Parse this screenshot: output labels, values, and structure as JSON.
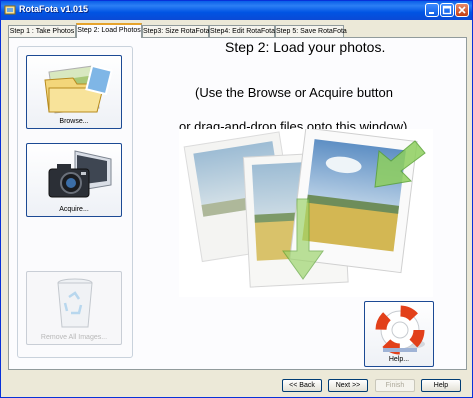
{
  "window": {
    "title": "RotaFota v1.015"
  },
  "tabs": [
    "Step 1 : Take Photos",
    "Step 2: Load Photos",
    "Step3: Size RotaFota",
    "Step4: Edit RotaFota",
    "Step 5: Save RotaFota"
  ],
  "main": {
    "heading": "Step 2: Load your photos.",
    "instruction_line1": "(Use the Browse or Acquire button",
    "instruction_line2": "or drag-and-drop files onto this window)"
  },
  "buttons": {
    "browse": "Browse...",
    "acquire": "Acquire...",
    "remove_all": "Remove All Images...",
    "help": "Help..."
  },
  "footer": {
    "back": "<< Back",
    "next": "Next >>",
    "finish": "Finish",
    "help": "Help"
  },
  "colors": {
    "title_bar": "#0054e3",
    "active_tab_accent": "#e6a32c",
    "button_border": "#1c4a94"
  },
  "icons": [
    "app-icon",
    "folder-photos-icon",
    "scanner-camera-icon",
    "recycle-bin-icon",
    "lifebuoy-icon",
    "green-arrow-icon"
  ]
}
